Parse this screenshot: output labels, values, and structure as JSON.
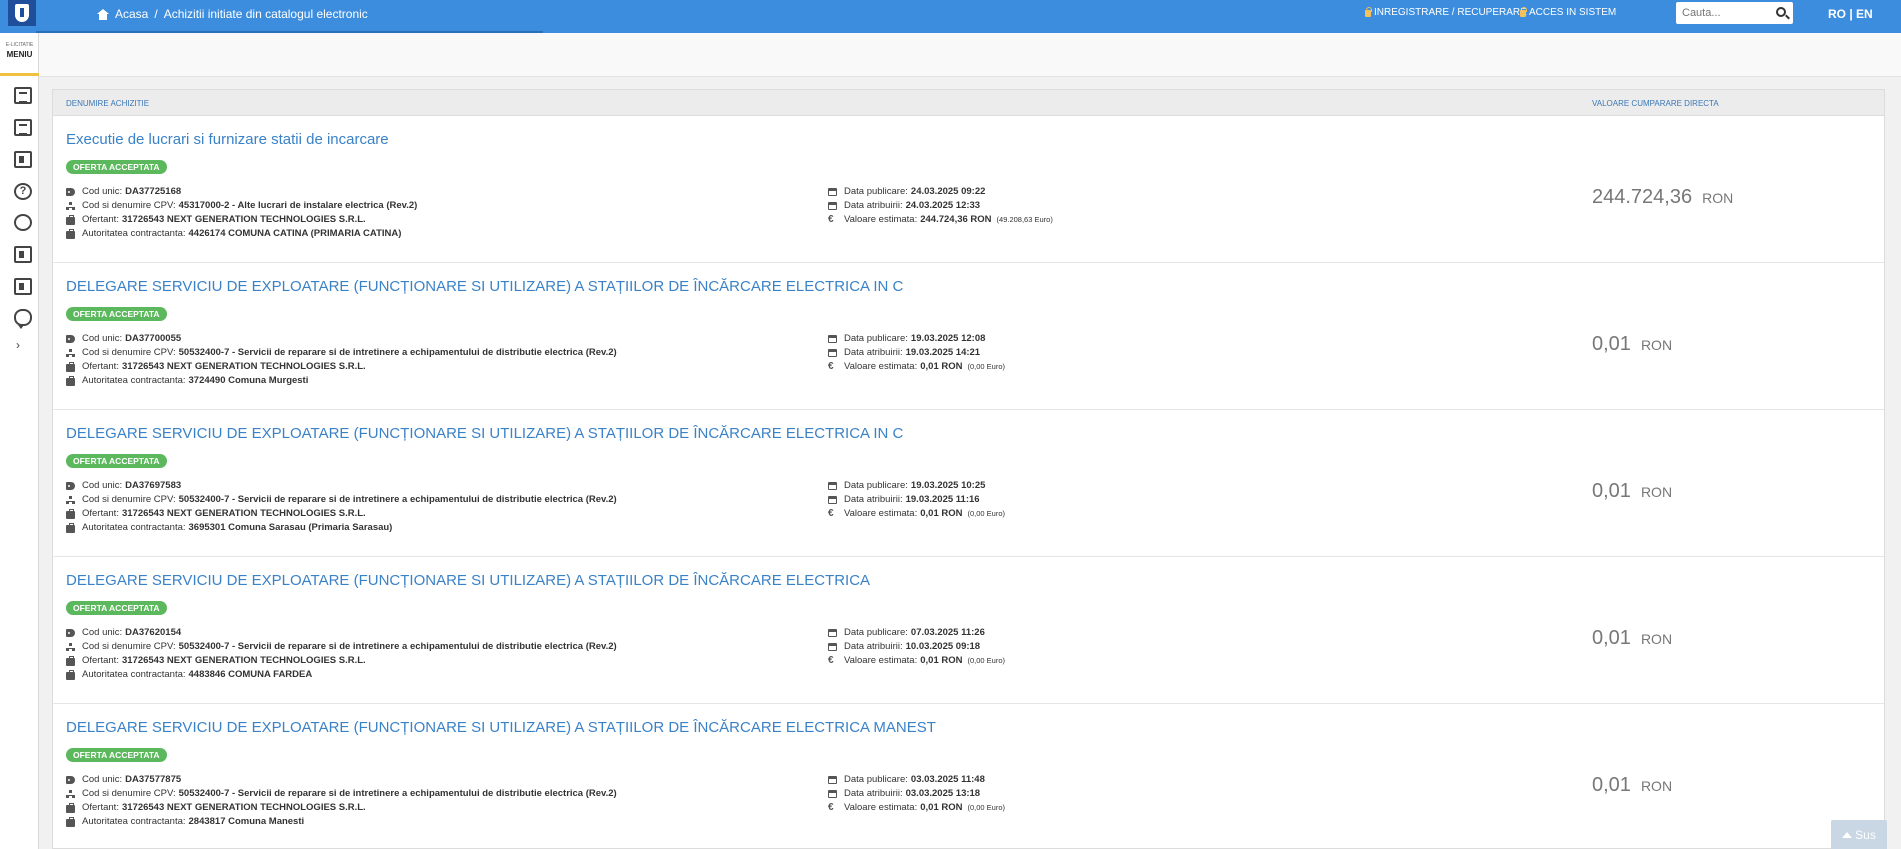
{
  "header": {
    "breadcrumb": {
      "home": "Acasa",
      "separator": "/",
      "current": "Achizitii initiate din catalogul electronic"
    },
    "nav": {
      "register": "INREGISTRARE / RECUPERARE",
      "login": "ACCES IN SISTEM"
    },
    "search": {
      "placeholder": "Cauta..."
    },
    "lang": "RO | EN",
    "colors": {
      "bar": "#3c8dde",
      "accent": "#f0c040"
    }
  },
  "sidebar": {
    "menu_small": "E-LICITATIE",
    "menu_label": "MENIU",
    "icons": [
      "document-icon",
      "export-icon",
      "book-icon",
      "help-icon",
      "touch-icon",
      "id-card-icon",
      "calculator-icon",
      "chat-icon"
    ],
    "expand": "›"
  },
  "table": {
    "col_name": "DENUMIRE ACHIZITIE",
    "col_value": "VALOARE CUMPARARE DIRECTA",
    "labels": {
      "cod_unic": "Cod unic:",
      "cpv": "Cod si denumire CPV:",
      "ofertant": "Ofertant:",
      "autoritate": "Autoritatea contractanta:",
      "data_publicare": "Data publicare:",
      "data_atribuire": "Data atribuirii:",
      "valoare_estimata": "Valoare estimata:",
      "euro_symbol": "€"
    },
    "rows": [
      {
        "title": "Executie de lucrari si furnizare statii de incarcare",
        "status": "OFERTA ACCEPTATA",
        "cod_unic": "DA37725168",
        "cpv": "45317000-2 - Alte lucrari de instalare electrica (Rev.2)",
        "ofertant": "31726543 NEXT GENERATION TECHNOLOGIES S.R.L.",
        "autoritate": "4426174 COMUNA CATINA (PRIMARIA CATINA)",
        "data_publicare": "24.03.2025 09:22",
        "data_atribuire": "24.03.2025 12:33",
        "valoare_estimata": "244.724,36  RON",
        "valoare_euro": "(49.208,63 Euro)",
        "price": "244.724,36",
        "currency": "RON"
      },
      {
        "title": "DELEGARE SERVICIU DE EXPLOATARE (FUNCȚIONARE SI UTILIZARE) A STAȚIILOR DE ÎNCĂRCARE ELECTRICA IN C",
        "status": "OFERTA ACCEPTATA",
        "cod_unic": "DA37700055",
        "cpv": "50532400-7 - Servicii de reparare si de intretinere a echipamentului de distributie electrica (Rev.2)",
        "ofertant": "31726543 NEXT GENERATION TECHNOLOGIES S.R.L.",
        "autoritate": "3724490 Comuna Murgesti",
        "data_publicare": "19.03.2025 12:08",
        "data_atribuire": "19.03.2025 14:21",
        "valoare_estimata": "0,01  RON",
        "valoare_euro": "(0,00 Euro)",
        "price": "0,01",
        "currency": "RON"
      },
      {
        "title": "DELEGARE SERVICIU DE EXPLOATARE (FUNCȚIONARE SI UTILIZARE) A STAȚIILOR DE ÎNCĂRCARE ELECTRICA IN C",
        "status": "OFERTA ACCEPTATA",
        "cod_unic": "DA37697583",
        "cpv": "50532400-7 - Servicii de reparare si de intretinere a echipamentului de distributie electrica (Rev.2)",
        "ofertant": "31726543 NEXT GENERATION TECHNOLOGIES S.R.L.",
        "autoritate": "3695301 Comuna Sarasau (Primaria Sarasau)",
        "data_publicare": "19.03.2025 10:25",
        "data_atribuire": "19.03.2025 11:16",
        "valoare_estimata": "0,01  RON",
        "valoare_euro": "(0,00 Euro)",
        "price": "0,01",
        "currency": "RON"
      },
      {
        "title": "DELEGARE SERVICIU DE EXPLOATARE (FUNCȚIONARE SI UTILIZARE) A STAȚIILOR DE ÎNCĂRCARE ELECTRICA",
        "status": "OFERTA ACCEPTATA",
        "cod_unic": "DA37620154",
        "cpv": "50532400-7 - Servicii de reparare si de intretinere a echipamentului de distributie electrica (Rev.2)",
        "ofertant": "31726543 NEXT GENERATION TECHNOLOGIES S.R.L.",
        "autoritate": "4483846 COMUNA FARDEA",
        "data_publicare": "07.03.2025 11:26",
        "data_atribuire": "10.03.2025 09:18",
        "valoare_estimata": "0,01  RON",
        "valoare_euro": "(0,00 Euro)",
        "price": "0,01",
        "currency": "RON"
      },
      {
        "title": "DELEGARE SERVICIU DE EXPLOATARE (FUNCȚIONARE SI UTILIZARE) A STAȚIILOR DE ÎNCĂRCARE ELECTRICA MANEST",
        "status": "OFERTA ACCEPTATA",
        "cod_unic": "DA37577875",
        "cpv": "50532400-7 - Servicii de reparare si de intretinere a echipamentului de distributie electrica (Rev.2)",
        "ofertant": "31726543 NEXT GENERATION TECHNOLOGIES S.R.L.",
        "autoritate": "2843817 Comuna Manesti",
        "data_publicare": "03.03.2025 11:48",
        "data_atribuire": "03.03.2025 13:18",
        "valoare_estimata": "0,01  RON",
        "valoare_euro": "(0,00 Euro)",
        "price": "0,01",
        "currency": "RON"
      }
    ]
  },
  "scroll_top": {
    "label": "Sus"
  }
}
